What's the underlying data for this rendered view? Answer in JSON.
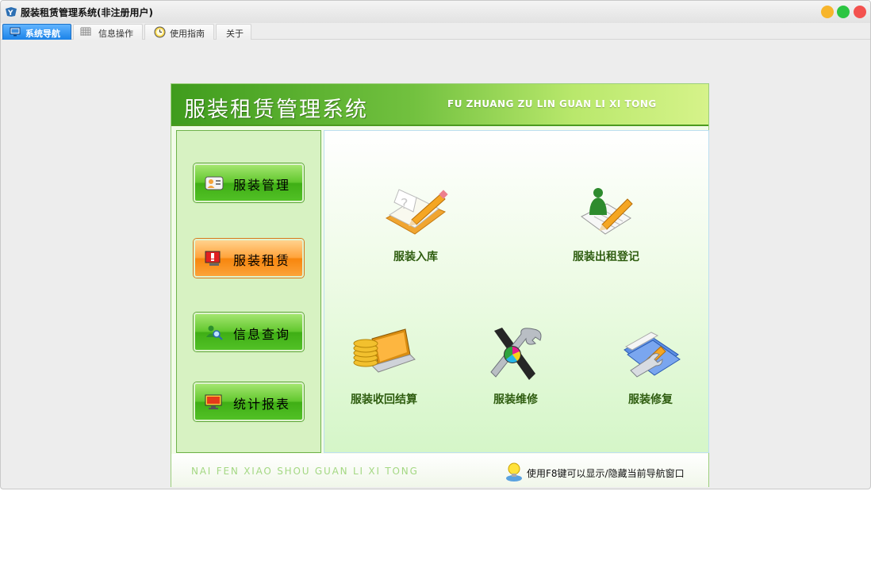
{
  "window": {
    "title": "服装租赁管理系统(非注册用户)"
  },
  "tabs": [
    {
      "label": "系统导航",
      "active": true,
      "icon": "monitor-icon"
    },
    {
      "label": "信息操作",
      "active": false,
      "icon": "grid-icon"
    },
    {
      "label": "使用指南",
      "active": false,
      "icon": "clock-icon"
    },
    {
      "label": "关于",
      "active": false
    }
  ],
  "header": {
    "title": "服装租赁管理系统",
    "subtitle": "FU ZHUANG ZU LIN GUAN LI XI TONG"
  },
  "nav": [
    {
      "label": "服装管理",
      "icon": "contact-card-icon"
    },
    {
      "label": "服装租赁",
      "icon": "alert-monitor-icon"
    },
    {
      "label": "信息查询",
      "icon": "search-people-icon"
    },
    {
      "label": "统计报表",
      "icon": "report-monitor-icon"
    }
  ],
  "functions": [
    {
      "label": "服装入库",
      "icon": "book-pencil-icon"
    },
    {
      "label": "服装出租登记",
      "icon": "person-document-icon"
    },
    {
      "label": "服装收回结算",
      "icon": "coins-laptop-icon"
    },
    {
      "label": "服装维修",
      "icon": "tools-icon"
    },
    {
      "label": "服装修复",
      "icon": "folder-wrench-icon"
    }
  ],
  "footer": {
    "left_text": "NAI FEN XIAO SHOU GUAN LI XI TONG",
    "tip": "使用F8键可以显示/隐藏当前导航窗口"
  },
  "colors": {
    "header_dark": "#3f9c1d",
    "header_light": "#d6f38a",
    "nav_green": "#52c126",
    "nav_orange": "#f7860e",
    "label_green": "#2f5d10",
    "tab_active": "#1a82e8"
  }
}
